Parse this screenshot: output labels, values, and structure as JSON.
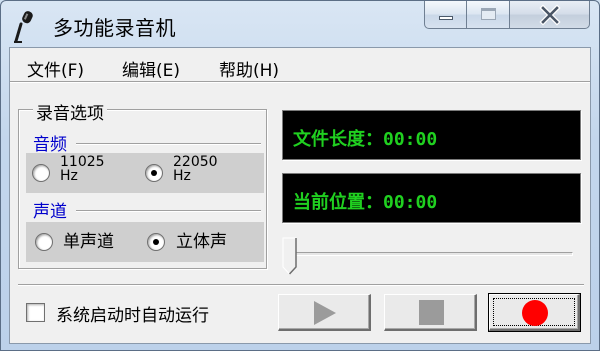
{
  "window": {
    "title": "多功能录音机",
    "icons": {
      "app": "microphone-icon",
      "minimize": "minimize-icon",
      "maximize": "maximize-icon",
      "close": "close-icon"
    }
  },
  "menu": {
    "items": [
      {
        "label": "文件(F)"
      },
      {
        "label": "编辑(E)"
      },
      {
        "label": "帮助(H)"
      }
    ]
  },
  "record_options": {
    "title": "录音选项",
    "audio_frequency": {
      "heading": "音频",
      "options": [
        {
          "label": "11025Hz",
          "selected": false
        },
        {
          "label": "22050Hz",
          "selected": true
        }
      ]
    },
    "channel": {
      "heading": "声道",
      "options": [
        {
          "label": "单声道",
          "selected": false
        },
        {
          "label": "立体声",
          "selected": true
        }
      ]
    }
  },
  "displays": {
    "file_length": "文件长度：00:00",
    "current_position": "当前位置：00:00",
    "text_color": "#20d020"
  },
  "position_slider": {
    "value": 0
  },
  "autostart": {
    "label": "系统启动时自动运行",
    "checked": false
  },
  "controls": {
    "play": {
      "icon": "play-icon",
      "enabled": false
    },
    "stop": {
      "icon": "stop-icon",
      "enabled": false
    },
    "record": {
      "icon": "record-icon",
      "enabled": true,
      "color": "#ff0000"
    }
  }
}
